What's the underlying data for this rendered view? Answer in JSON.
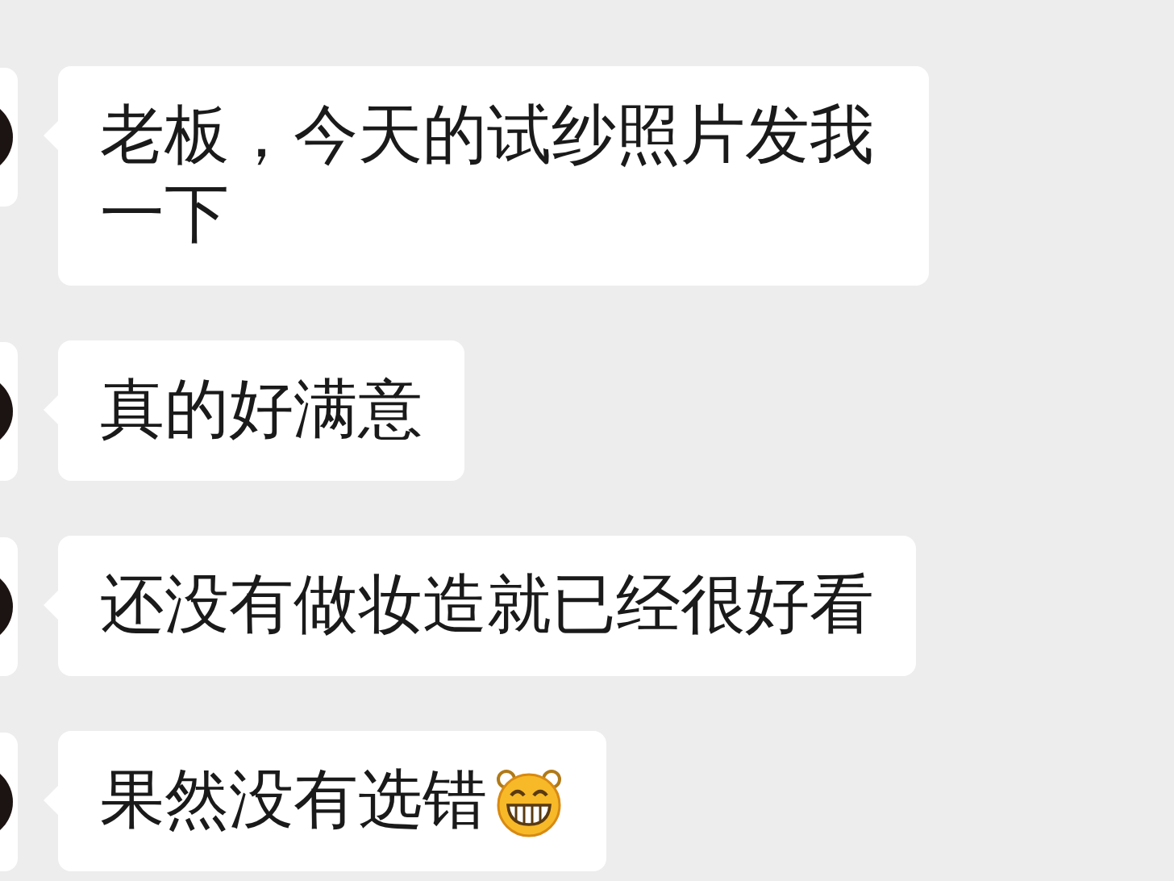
{
  "messages": [
    {
      "text": "老板，今天的试纱照片发我一下",
      "emoji": false
    },
    {
      "text": "真的好满意",
      "emoji": false
    },
    {
      "text": "还没有做妆造就已经很好看",
      "emoji": false
    },
    {
      "text": "果然没有选错",
      "emoji": true
    }
  ]
}
